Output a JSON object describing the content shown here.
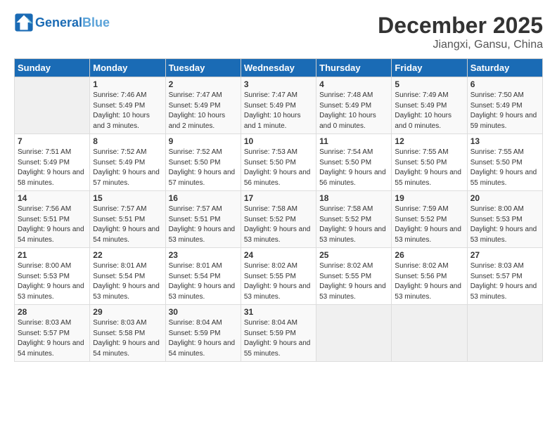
{
  "header": {
    "logo_general": "General",
    "logo_blue": "Blue",
    "title": "December 2025",
    "subtitle": "Jiangxi, Gansu, China"
  },
  "days_of_week": [
    "Sunday",
    "Monday",
    "Tuesday",
    "Wednesday",
    "Thursday",
    "Friday",
    "Saturday"
  ],
  "weeks": [
    [
      {
        "day": "",
        "empty": true
      },
      {
        "day": "1",
        "sunrise": "7:46 AM",
        "sunset": "5:49 PM",
        "daylight": "10 hours and 3 minutes."
      },
      {
        "day": "2",
        "sunrise": "7:47 AM",
        "sunset": "5:49 PM",
        "daylight": "10 hours and 2 minutes."
      },
      {
        "day": "3",
        "sunrise": "7:47 AM",
        "sunset": "5:49 PM",
        "daylight": "10 hours and 1 minute."
      },
      {
        "day": "4",
        "sunrise": "7:48 AM",
        "sunset": "5:49 PM",
        "daylight": "10 hours and 0 minutes."
      },
      {
        "day": "5",
        "sunrise": "7:49 AM",
        "sunset": "5:49 PM",
        "daylight": "10 hours and 0 minutes."
      },
      {
        "day": "6",
        "sunrise": "7:50 AM",
        "sunset": "5:49 PM",
        "daylight": "9 hours and 59 minutes."
      }
    ],
    [
      {
        "day": "7",
        "sunrise": "7:51 AM",
        "sunset": "5:49 PM",
        "daylight": "9 hours and 58 minutes."
      },
      {
        "day": "8",
        "sunrise": "7:52 AM",
        "sunset": "5:49 PM",
        "daylight": "9 hours and 57 minutes."
      },
      {
        "day": "9",
        "sunrise": "7:52 AM",
        "sunset": "5:50 PM",
        "daylight": "9 hours and 57 minutes."
      },
      {
        "day": "10",
        "sunrise": "7:53 AM",
        "sunset": "5:50 PM",
        "daylight": "9 hours and 56 minutes."
      },
      {
        "day": "11",
        "sunrise": "7:54 AM",
        "sunset": "5:50 PM",
        "daylight": "9 hours and 56 minutes."
      },
      {
        "day": "12",
        "sunrise": "7:55 AM",
        "sunset": "5:50 PM",
        "daylight": "9 hours and 55 minutes."
      },
      {
        "day": "13",
        "sunrise": "7:55 AM",
        "sunset": "5:50 PM",
        "daylight": "9 hours and 55 minutes."
      }
    ],
    [
      {
        "day": "14",
        "sunrise": "7:56 AM",
        "sunset": "5:51 PM",
        "daylight": "9 hours and 54 minutes."
      },
      {
        "day": "15",
        "sunrise": "7:57 AM",
        "sunset": "5:51 PM",
        "daylight": "9 hours and 54 minutes."
      },
      {
        "day": "16",
        "sunrise": "7:57 AM",
        "sunset": "5:51 PM",
        "daylight": "9 hours and 53 minutes."
      },
      {
        "day": "17",
        "sunrise": "7:58 AM",
        "sunset": "5:52 PM",
        "daylight": "9 hours and 53 minutes."
      },
      {
        "day": "18",
        "sunrise": "7:58 AM",
        "sunset": "5:52 PM",
        "daylight": "9 hours and 53 minutes."
      },
      {
        "day": "19",
        "sunrise": "7:59 AM",
        "sunset": "5:52 PM",
        "daylight": "9 hours and 53 minutes."
      },
      {
        "day": "20",
        "sunrise": "8:00 AM",
        "sunset": "5:53 PM",
        "daylight": "9 hours and 53 minutes."
      }
    ],
    [
      {
        "day": "21",
        "sunrise": "8:00 AM",
        "sunset": "5:53 PM",
        "daylight": "9 hours and 53 minutes."
      },
      {
        "day": "22",
        "sunrise": "8:01 AM",
        "sunset": "5:54 PM",
        "daylight": "9 hours and 53 minutes."
      },
      {
        "day": "23",
        "sunrise": "8:01 AM",
        "sunset": "5:54 PM",
        "daylight": "9 hours and 53 minutes."
      },
      {
        "day": "24",
        "sunrise": "8:02 AM",
        "sunset": "5:55 PM",
        "daylight": "9 hours and 53 minutes."
      },
      {
        "day": "25",
        "sunrise": "8:02 AM",
        "sunset": "5:55 PM",
        "daylight": "9 hours and 53 minutes."
      },
      {
        "day": "26",
        "sunrise": "8:02 AM",
        "sunset": "5:56 PM",
        "daylight": "9 hours and 53 minutes."
      },
      {
        "day": "27",
        "sunrise": "8:03 AM",
        "sunset": "5:57 PM",
        "daylight": "9 hours and 53 minutes."
      }
    ],
    [
      {
        "day": "28",
        "sunrise": "8:03 AM",
        "sunset": "5:57 PM",
        "daylight": "9 hours and 54 minutes."
      },
      {
        "day": "29",
        "sunrise": "8:03 AM",
        "sunset": "5:58 PM",
        "daylight": "9 hours and 54 minutes."
      },
      {
        "day": "30",
        "sunrise": "8:04 AM",
        "sunset": "5:59 PM",
        "daylight": "9 hours and 54 minutes."
      },
      {
        "day": "31",
        "sunrise": "8:04 AM",
        "sunset": "5:59 PM",
        "daylight": "9 hours and 55 minutes."
      },
      {
        "day": "",
        "empty": true
      },
      {
        "day": "",
        "empty": true
      },
      {
        "day": "",
        "empty": true
      }
    ]
  ]
}
